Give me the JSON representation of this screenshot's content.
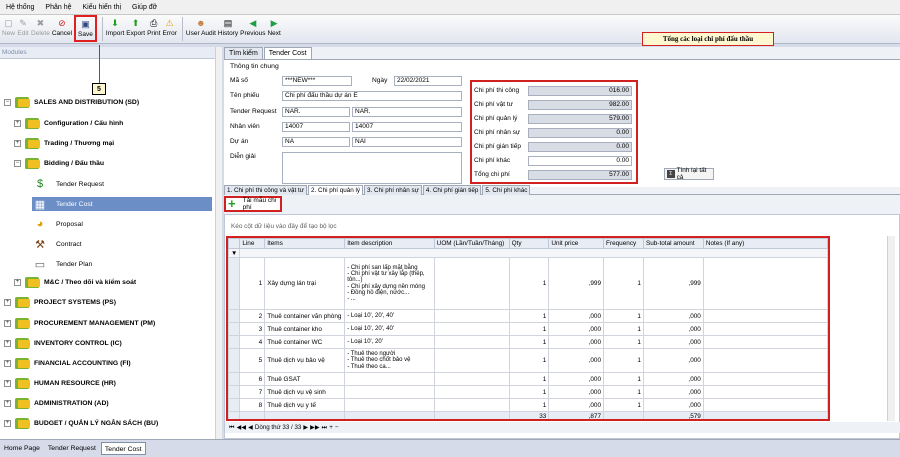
{
  "menu": [
    "Hệ thống",
    "Phân hệ",
    "Kiểu hiển thị",
    "Giúp đỡ"
  ],
  "toolbar": {
    "new": "New",
    "edit": "Edit",
    "delete": "Delete",
    "cancel": "Cancel",
    "save": "Save",
    "import": "Import",
    "export": "Export",
    "print": "Print",
    "error": "Error",
    "user_audit": "User Audit",
    "history": "History",
    "previous": "Previous",
    "next": "Next"
  },
  "callout_step": "5",
  "annotation": "Tổng các loại chi phí đấu thầu",
  "left": {
    "header": "Modules",
    "tree": [
      {
        "label": "SALES AND DISTRIBUTION (SD)",
        "bold": true
      },
      {
        "label": "Configuration / Cấu hình",
        "bold": true
      },
      {
        "label": "Trading / Thương mại",
        "bold": true
      },
      {
        "label": "Bidding / Đấu thầu",
        "bold": true
      },
      {
        "label": "Tender Request"
      },
      {
        "label": "Tender Cost"
      },
      {
        "label": "Proposal"
      },
      {
        "label": "Contract"
      },
      {
        "label": "Tender Plan"
      },
      {
        "label": "M&C / Theo dõi và kiểm soát",
        "bold": true
      },
      {
        "label": "PROJECT SYSTEMS (PS)",
        "bold": true
      },
      {
        "label": "PROCUREMENT MANAGEMENT (PM)",
        "bold": true
      },
      {
        "label": "INVENTORY CONTROL (IC)",
        "bold": true
      },
      {
        "label": "FINANCIAL ACCOUNTING (FI)",
        "bold": true
      },
      {
        "label": "HUMAN RESOURCE (HR)",
        "bold": true
      },
      {
        "label": "ADMINISTRATION (AD)",
        "bold": true
      },
      {
        "label": "BUDGET / QUẢN LÝ NGÂN SÁCH (BU)",
        "bold": true
      }
    ]
  },
  "bottom_tabs": [
    "Home Page",
    "Tender Request",
    "Tender Cost"
  ],
  "tabs": [
    "Tìm kiếm",
    "Tender Cost"
  ],
  "form": {
    "section": "Thông tin chung",
    "ma_so_label": "Mã số",
    "ma_so": "***NEW***",
    "ngay_label": "Ngày",
    "ngay": "22/02/2021",
    "ten_phieu_label": "Tên phiếu",
    "ten_phieu": "Chi phí đấu thầu dự án E",
    "tender_request_label": "Tender Request",
    "tender_request_code": "NAR.",
    "tender_request_name": "NAR.",
    "nhan_vien_label": "Nhân viên",
    "nhan_vien_code": "14007",
    "nhan_vien_name": "14007",
    "du_an_label": "Dự án",
    "du_an_code": "NA",
    "du_an_name": "NAI",
    "dien_giai_label": "Diễn giải"
  },
  "costs": [
    {
      "label": "Chi phí thi công",
      "value": "016.00"
    },
    {
      "label": "Chi phí vật tư",
      "value": "982.00"
    },
    {
      "label": "Chi phí quản lý",
      "value": "579.00"
    },
    {
      "label": "Chi phí nhân sự",
      "value": "0.00"
    },
    {
      "label": "Chi phí gián tiếp",
      "value": "0.00"
    },
    {
      "label": "Chi phí khác",
      "value": "0.00"
    },
    {
      "label": "Tổng chi phí",
      "value": "577.00"
    }
  ],
  "recalc_label": "Tính lại tất cả",
  "sub_tabs": [
    "1. Chi phí thi công và vật tư",
    "2. Chi phí quản lý",
    "3. Chi phí nhân sự",
    "4. Chi phí gián tiếp",
    "5. Chi phí khác"
  ],
  "template_label": "Tải mẫu chi phí",
  "group_hint": "Kéo cột dữ liệu vào đây để tạo bộ lọc",
  "grid": {
    "columns": [
      "Line",
      "Items",
      "Item description",
      "UOM (Lần/Tuần/Tháng)",
      "Qty",
      "Unit price",
      "Frequency",
      "Sub-total amount",
      "Notes (If any)"
    ],
    "rows": [
      {
        "line": "1",
        "item": "Xây dựng lán trại",
        "desc": "- Chi phí san lấp mặt bằng\n- Chi phí vật tư xây lắp (thép, tôn...)\n- Chi phí xây dựng nền móng\n- Đồng hồ điện, nước...\n- ...",
        "qty": "1",
        "price": ",999",
        "freq": "1",
        "sub": ",999"
      },
      {
        "line": "2",
        "item": "Thuê container văn phòng",
        "desc": "- Loại 10', 20', 40'",
        "qty": "1",
        "price": ",000",
        "freq": "1",
        "sub": ",000"
      },
      {
        "line": "3",
        "item": "Thuê container kho",
        "desc": "- Loại 10', 20', 40'",
        "qty": "1",
        "price": ",000",
        "freq": "1",
        "sub": ",000"
      },
      {
        "line": "4",
        "item": "Thuê container WC",
        "desc": "- Loại 10', 20'",
        "qty": "1",
        "price": ",000",
        "freq": "1",
        "sub": ",000"
      },
      {
        "line": "5",
        "item": "Thuê dịch vụ bảo vệ",
        "desc": "- Thuê theo người\n- Thuê theo chốt bảo vệ\n- Thuê theo ca...",
        "qty": "1",
        "price": ",000",
        "freq": "1",
        "sub": ",000"
      },
      {
        "line": "6",
        "item": "Thuê GSAT",
        "desc": "",
        "qty": "1",
        "price": ",000",
        "freq": "1",
        "sub": ",000"
      },
      {
        "line": "7",
        "item": "Thuê dịch vụ vệ sinh",
        "desc": "",
        "qty": "1",
        "price": ",000",
        "freq": "1",
        "sub": ",000"
      },
      {
        "line": "8",
        "item": "Thuê dịch vụ y tế",
        "desc": "",
        "qty": "1",
        "price": ",000",
        "freq": "1",
        "sub": ",000"
      }
    ],
    "totals": {
      "qty": "33",
      "price": ",877",
      "sub": ",579"
    }
  },
  "nav_record": "Dòng thứ 33 / 33"
}
